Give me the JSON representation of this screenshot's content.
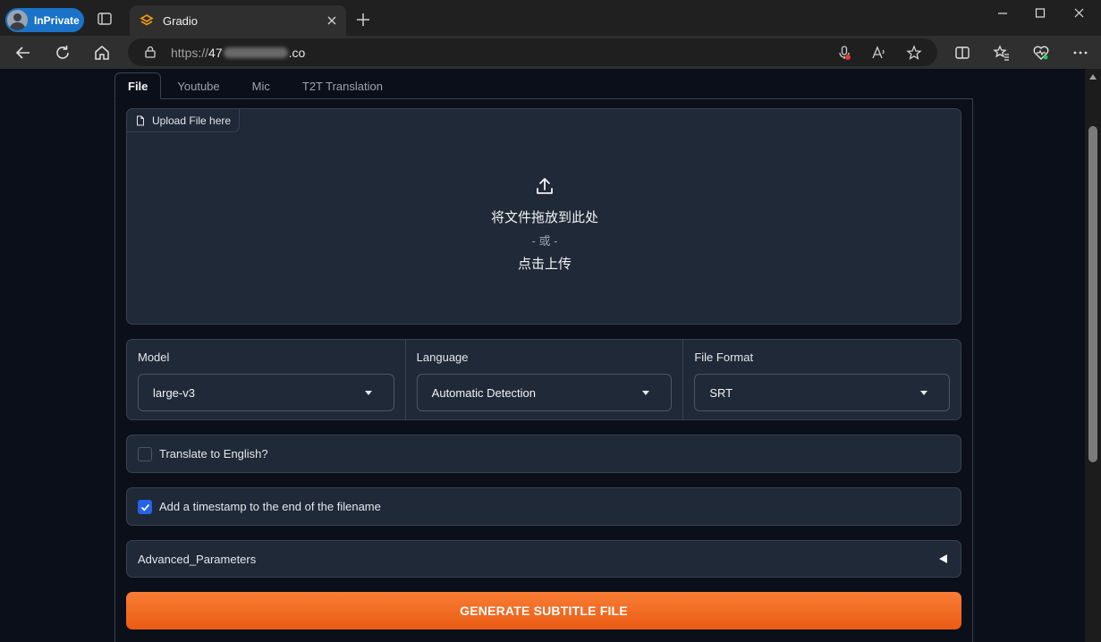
{
  "browser": {
    "inprivate_label": "InPrivate",
    "tab_title": "Gradio",
    "url_prefix": "https://",
    "url_visible_start": "47",
    "url_visible_end": ".co"
  },
  "app": {
    "tabs": [
      {
        "label": "File",
        "active": true
      },
      {
        "label": "Youtube",
        "active": false
      },
      {
        "label": "Mic",
        "active": false
      },
      {
        "label": "T2T Translation",
        "active": false
      }
    ],
    "upload": {
      "label": "Upload File here",
      "drop_text": "将文件拖放到此处",
      "or_text": "- 或 -",
      "click_text": "点击上传"
    },
    "dropdowns": [
      {
        "label": "Model",
        "value": "large-v3"
      },
      {
        "label": "Language",
        "value": "Automatic Detection"
      },
      {
        "label": "File Format",
        "value": "SRT"
      }
    ],
    "translate_checkbox": {
      "label": "Translate to English?",
      "checked": false
    },
    "timestamp_checkbox": {
      "label": "Add a timestamp to the end of the filename",
      "checked": true
    },
    "advanced": {
      "label": "Advanced_Parameters"
    },
    "generate_button": {
      "label": "GENERATE SUBTITLE FILE"
    }
  },
  "colors": {
    "page_background": "#0b0f19",
    "panel_background": "#1f2937",
    "border": "#374151",
    "accent_orange": "#ea5b14",
    "checkbox_blue": "#2563eb"
  }
}
